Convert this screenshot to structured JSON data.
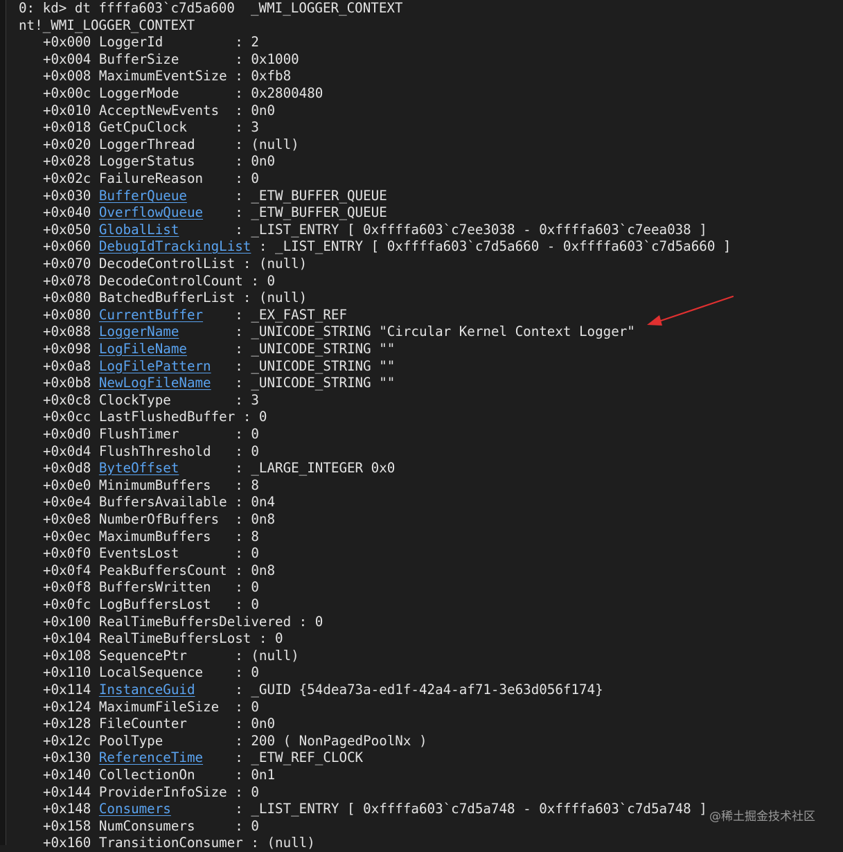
{
  "command_line": "0: kd> dt ffffa603`c7d5a600  _WMI_LOGGER_CONTEXT",
  "type_line": "nt!_WMI_LOGGER_CONTEXT",
  "members": [
    {
      "offset": "+0x000",
      "field": "LoggerId",
      "link": false,
      "sep": "         : ",
      "value": "2"
    },
    {
      "offset": "+0x004",
      "field": "BufferSize",
      "link": false,
      "sep": "       : ",
      "value": "0x1000"
    },
    {
      "offset": "+0x008",
      "field": "MaximumEventSize",
      "link": false,
      "sep": " : ",
      "value": "0xfb8"
    },
    {
      "offset": "+0x00c",
      "field": "LoggerMode",
      "link": false,
      "sep": "       : ",
      "value": "0x2800480"
    },
    {
      "offset": "+0x010",
      "field": "AcceptNewEvents",
      "link": false,
      "sep": "  : ",
      "value": "0n0"
    },
    {
      "offset": "+0x018",
      "field": "GetCpuClock",
      "link": false,
      "sep": "      : ",
      "value": "3"
    },
    {
      "offset": "+0x020",
      "field": "LoggerThread",
      "link": false,
      "sep": "     : ",
      "value": "(null)"
    },
    {
      "offset": "+0x028",
      "field": "LoggerStatus",
      "link": false,
      "sep": "     : ",
      "value": "0n0"
    },
    {
      "offset": "+0x02c",
      "field": "FailureReason",
      "link": false,
      "sep": "    : ",
      "value": "0"
    },
    {
      "offset": "+0x030",
      "field": "BufferQueue",
      "link": true,
      "sep": "      : ",
      "value": "_ETW_BUFFER_QUEUE"
    },
    {
      "offset": "+0x040",
      "field": "OverflowQueue",
      "link": true,
      "sep": "    : ",
      "value": "_ETW_BUFFER_QUEUE"
    },
    {
      "offset": "+0x050",
      "field": "GlobalList",
      "link": true,
      "sep": "       : ",
      "value": "_LIST_ENTRY [ 0xffffa603`c7ee3038 - 0xffffa603`c7eea038 ]"
    },
    {
      "offset": "+0x060",
      "field": "DebugIdTrackingList",
      "link": true,
      "sep": " : ",
      "value": "_LIST_ENTRY [ 0xffffa603`c7d5a660 - 0xffffa603`c7d5a660 ]"
    },
    {
      "offset": "+0x070",
      "field": "DecodeControlList",
      "link": false,
      "sep": " : ",
      "value": "(null)"
    },
    {
      "offset": "+0x078",
      "field": "DecodeControlCount",
      "link": false,
      "sep": " : ",
      "value": "0"
    },
    {
      "offset": "+0x080",
      "field": "BatchedBufferList",
      "link": false,
      "sep": " : ",
      "value": "(null)"
    },
    {
      "offset": "+0x080",
      "field": "CurrentBuffer",
      "link": true,
      "sep": "    : ",
      "value": "_EX_FAST_REF"
    },
    {
      "offset": "+0x088",
      "field": "LoggerName",
      "link": true,
      "sep": "       : ",
      "value": "_UNICODE_STRING \"Circular Kernel Context Logger\""
    },
    {
      "offset": "+0x098",
      "field": "LogFileName",
      "link": true,
      "sep": "      : ",
      "value": "_UNICODE_STRING \"\""
    },
    {
      "offset": "+0x0a8",
      "field": "LogFilePattern",
      "link": true,
      "sep": "   : ",
      "value": "_UNICODE_STRING \"\""
    },
    {
      "offset": "+0x0b8",
      "field": "NewLogFileName",
      "link": true,
      "sep": "   : ",
      "value": "_UNICODE_STRING \"\""
    },
    {
      "offset": "+0x0c8",
      "field": "ClockType",
      "link": false,
      "sep": "        : ",
      "value": "3"
    },
    {
      "offset": "+0x0cc",
      "field": "LastFlushedBuffer",
      "link": false,
      "sep": " : ",
      "value": "0"
    },
    {
      "offset": "+0x0d0",
      "field": "FlushTimer",
      "link": false,
      "sep": "       : ",
      "value": "0"
    },
    {
      "offset": "+0x0d4",
      "field": "FlushThreshold",
      "link": false,
      "sep": "   : ",
      "value": "0"
    },
    {
      "offset": "+0x0d8",
      "field": "ByteOffset",
      "link": true,
      "sep": "       : ",
      "value": "_LARGE_INTEGER 0x0"
    },
    {
      "offset": "+0x0e0",
      "field": "MinimumBuffers",
      "link": false,
      "sep": "   : ",
      "value": "8"
    },
    {
      "offset": "+0x0e4",
      "field": "BuffersAvailable",
      "link": false,
      "sep": " : ",
      "value": "0n4"
    },
    {
      "offset": "+0x0e8",
      "field": "NumberOfBuffers",
      "link": false,
      "sep": "  : ",
      "value": "0n8"
    },
    {
      "offset": "+0x0ec",
      "field": "MaximumBuffers",
      "link": false,
      "sep": "   : ",
      "value": "8"
    },
    {
      "offset": "+0x0f0",
      "field": "EventsLost",
      "link": false,
      "sep": "       : ",
      "value": "0"
    },
    {
      "offset": "+0x0f4",
      "field": "PeakBuffersCount",
      "link": false,
      "sep": " : ",
      "value": "0n8"
    },
    {
      "offset": "+0x0f8",
      "field": "BuffersWritten",
      "link": false,
      "sep": "   : ",
      "value": "0"
    },
    {
      "offset": "+0x0fc",
      "field": "LogBuffersLost",
      "link": false,
      "sep": "   : ",
      "value": "0"
    },
    {
      "offset": "+0x100",
      "field": "RealTimeBuffersDelivered",
      "link": false,
      "sep": " : ",
      "value": "0"
    },
    {
      "offset": "+0x104",
      "field": "RealTimeBuffersLost",
      "link": false,
      "sep": " : ",
      "value": "0"
    },
    {
      "offset": "+0x108",
      "field": "SequencePtr",
      "link": false,
      "sep": "      : ",
      "value": "(null)"
    },
    {
      "offset": "+0x110",
      "field": "LocalSequence",
      "link": false,
      "sep": "    : ",
      "value": "0"
    },
    {
      "offset": "+0x114",
      "field": "InstanceGuid",
      "link": true,
      "sep": "     : ",
      "value": "_GUID {54dea73a-ed1f-42a4-af71-3e63d056f174}"
    },
    {
      "offset": "+0x124",
      "field": "MaximumFileSize",
      "link": false,
      "sep": "  : ",
      "value": "0"
    },
    {
      "offset": "+0x128",
      "field": "FileCounter",
      "link": false,
      "sep": "      : ",
      "value": "0n0"
    },
    {
      "offset": "+0x12c",
      "field": "PoolType",
      "link": false,
      "sep": "         : ",
      "value": "200 ( NonPagedPoolNx )"
    },
    {
      "offset": "+0x130",
      "field": "ReferenceTime",
      "link": true,
      "sep": "    : ",
      "value": "_ETW_REF_CLOCK"
    },
    {
      "offset": "+0x140",
      "field": "CollectionOn",
      "link": false,
      "sep": "     : ",
      "value": "0n1"
    },
    {
      "offset": "+0x144",
      "field": "ProviderInfoSize",
      "link": false,
      "sep": " : ",
      "value": "0"
    },
    {
      "offset": "+0x148",
      "field": "Consumers",
      "link": true,
      "sep": "        : ",
      "value": "_LIST_ENTRY [ 0xffffa603`c7d5a748 - 0xffffa603`c7d5a748 ]"
    },
    {
      "offset": "+0x158",
      "field": "NumConsumers",
      "link": false,
      "sep": "     : ",
      "value": "0"
    },
    {
      "offset": "+0x160",
      "field": "TransitionConsumer",
      "link": false,
      "sep": " : ",
      "value": "(null)"
    }
  ],
  "watermark": "@稀土掘金技术社区",
  "colors": {
    "background": "#1e1e1e",
    "text": "#e4e4e4",
    "link": "#5aa3f0",
    "arrow": "#e03030"
  },
  "annotation": {
    "icon": "red-arrow-icon",
    "points_to": "LoggerName"
  }
}
